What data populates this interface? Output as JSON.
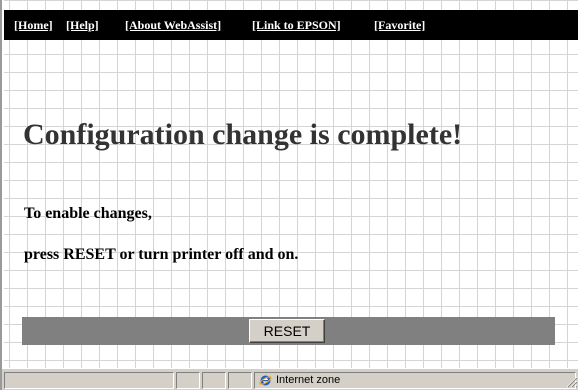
{
  "nav": {
    "home": "[Home]",
    "help": "[Help]",
    "about": "[About WebAssist]",
    "epson": "[Link to EPSON]",
    "favorite": "[Favorite]"
  },
  "main": {
    "headline": "Configuration change is complete!",
    "line1": "To enable changes,",
    "line2": "press RESET or turn printer off and on.",
    "reset_label": "RESET"
  },
  "statusbar": {
    "zone_label": "Internet zone",
    "zone_icon": "internet-explorer-icon"
  },
  "colors": {
    "nav_bg": "#000000",
    "nav_text": "#ffffff",
    "headline_text": "#333333",
    "reset_bar": "#808080",
    "chrome": "#d4d0c8"
  }
}
